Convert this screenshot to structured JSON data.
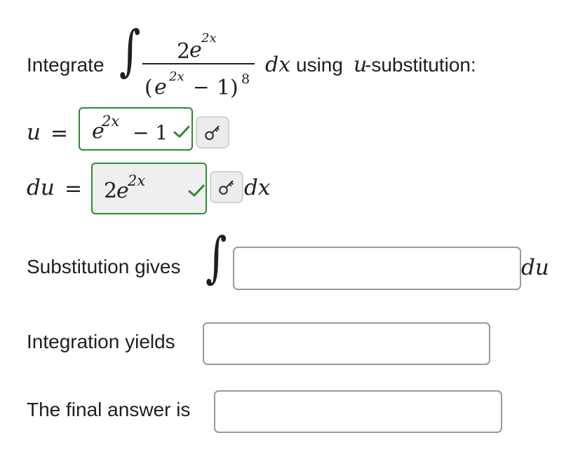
{
  "prompt": {
    "prefix": "Integrate",
    "numerator": {
      "coef": "2",
      "base": "e",
      "exponent": "2x"
    },
    "denominator": {
      "open": "(",
      "base": "e",
      "exponent": "2x",
      "minus": "−",
      "one": "1",
      "close": ")",
      "power": "8"
    },
    "dx": "dx",
    "suffix_using": "using",
    "u_var": "u",
    "suffix_substitution": "-substitution:"
  },
  "u_row": {
    "label": "u",
    "equals": "=",
    "answer": {
      "base": "e",
      "exponent": "2x",
      "tail": "− 1"
    },
    "status": "correct"
  },
  "du_row": {
    "label": "du",
    "equals": "=",
    "answer": {
      "coef": "2",
      "base": "e",
      "exponent": "2x"
    },
    "status": "correct",
    "after": "dx"
  },
  "substitution_row": {
    "label": "Substitution gives",
    "after": "du",
    "input_value": ""
  },
  "integration_row": {
    "label": "Integration yields",
    "input_value": ""
  },
  "final_row": {
    "label": "The final answer is",
    "input_value": ""
  },
  "icons": {
    "key": "key-icon",
    "check": "check-icon"
  },
  "colors": {
    "correct_green": "#2f8a2f",
    "input_border": "#9c9c9c",
    "filled_bg": "#efefef",
    "key_bg": "#ececec"
  }
}
